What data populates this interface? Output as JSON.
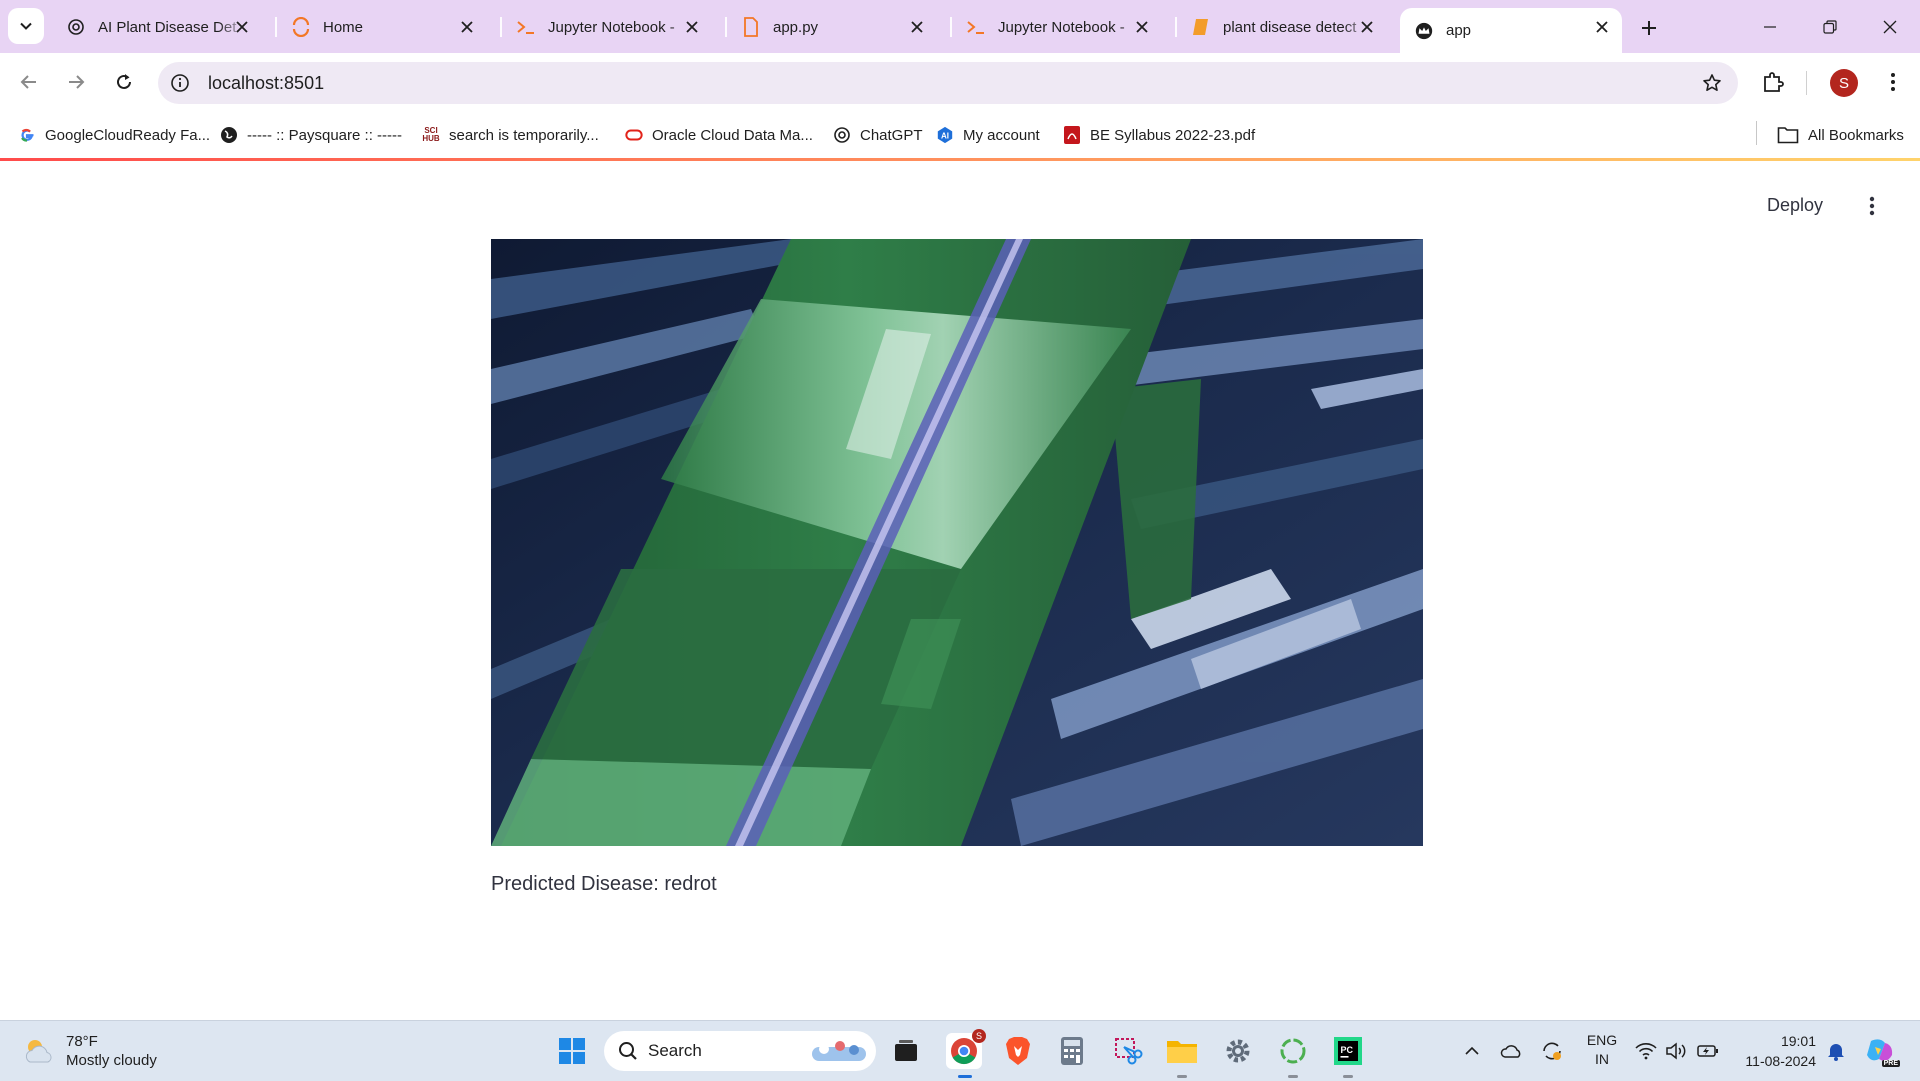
{
  "browser": {
    "tabs": [
      {
        "title": "AI Plant Disease Det",
        "icon": "openai-icon"
      },
      {
        "title": "Home",
        "icon": "jupyter-icon"
      },
      {
        "title": "Jupyter Notebook -",
        "icon": "terminal-icon"
      },
      {
        "title": "app.py",
        "icon": "file-icon"
      },
      {
        "title": "Jupyter Notebook -",
        "icon": "terminal-icon"
      },
      {
        "title": "plant disease detect",
        "icon": "book-icon"
      },
      {
        "title": "app",
        "icon": "streamlit-crown-icon"
      }
    ],
    "active_tab": 6,
    "url": "localhost:8501",
    "profile_initial": "S"
  },
  "bookmarks": [
    {
      "label": "GoogleCloudReady Fa...",
      "icon": "google-icon"
    },
    {
      "label": "----- :: Paysquare :: -----",
      "icon": "globe-icon"
    },
    {
      "label": "search is temporarily...",
      "icon": "scihub-icon"
    },
    {
      "label": "Oracle Cloud Data Ma...",
      "icon": "oracle-icon"
    },
    {
      "label": "ChatGPT",
      "icon": "openai-icon"
    },
    {
      "label": "My account",
      "icon": "ai-icon"
    },
    {
      "label": "BE Syllabus 2022-23.pdf",
      "icon": "pdf-icon"
    },
    {
      "label": "All Bookmarks",
      "icon": "folder-icon"
    }
  ],
  "app": {
    "deploy_label": "Deploy",
    "prediction_text": "Predicted Disease: redrot",
    "image_alt": "uploaded plant stalk image"
  },
  "taskbar": {
    "weather_temp": "78°F",
    "weather_desc": "Mostly cloudy",
    "search_label": "Search",
    "lang_top": "ENG",
    "lang_bottom": "IN",
    "time": "19:01",
    "date": "11-08-2024",
    "chrome_badge": "S",
    "copilot_badge": "PRE"
  },
  "colors": {
    "tabstrip_bg": "#e8d4f4",
    "accent": "#ff4b4b",
    "taskbar_bg": "#dde6f1"
  }
}
